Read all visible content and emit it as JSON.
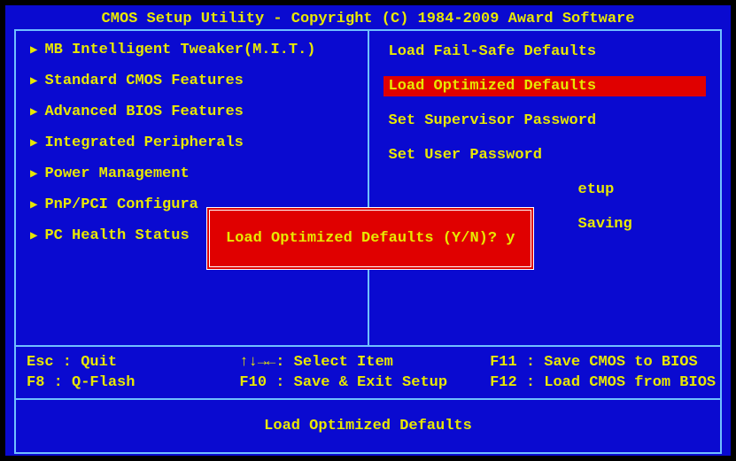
{
  "header": {
    "title": "CMOS Setup Utility - Copyright (C) 1984-2009 Award Software"
  },
  "menu": {
    "left": [
      {
        "label": "MB Intelligent Tweaker(M.I.T.)"
      },
      {
        "label": "Standard CMOS Features"
      },
      {
        "label": "Advanced BIOS Features"
      },
      {
        "label": "Integrated Peripherals"
      },
      {
        "label": "Power Management"
      },
      {
        "label": "PnP/PCI Configura"
      },
      {
        "label": "PC Health Status"
      }
    ],
    "right": [
      {
        "label": "Load Fail-Safe Defaults",
        "selected": false
      },
      {
        "label": "Load Optimized Defaults",
        "selected": true
      },
      {
        "label": "Set Supervisor Password",
        "selected": false
      },
      {
        "label": "Set User Password",
        "selected": false
      },
      {
        "label": "etup",
        "selected": false
      },
      {
        "label": "Saving",
        "selected": false
      }
    ]
  },
  "help": {
    "esc": "Esc : Quit",
    "f8": "F8  : Q-Flash",
    "nav": "↑↓→←: Select Item",
    "f10": "F10 : Save & Exit Setup",
    "f11": "F11 : Save CMOS to BIOS",
    "f12": "F12 : Load CMOS from BIOS"
  },
  "footer": {
    "status": "Load Optimized Defaults"
  },
  "dialog": {
    "prompt": "Load Optimized Defaults (Y/N)? y"
  }
}
